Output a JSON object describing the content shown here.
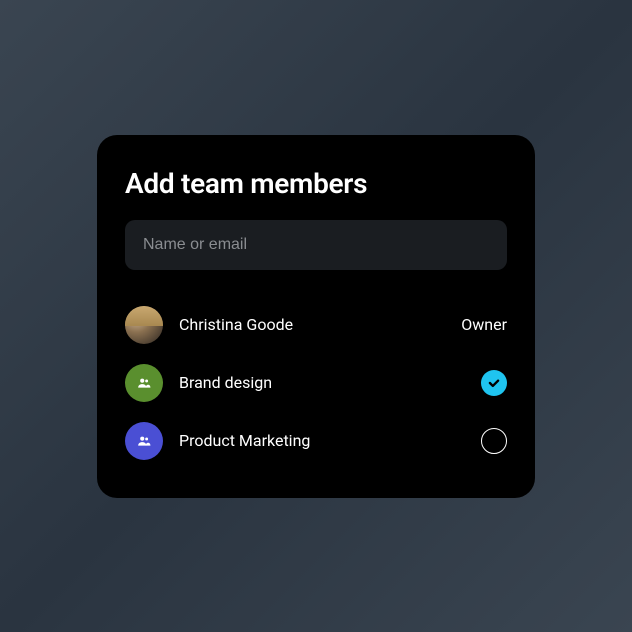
{
  "modal": {
    "title": "Add team members",
    "search_placeholder": "Name or email"
  },
  "members": [
    {
      "name": "Christina Goode",
      "role": "Owner",
      "avatar_type": "photo"
    },
    {
      "name": "Brand design",
      "avatar_type": "group",
      "avatar_color": "green",
      "selected": true
    },
    {
      "name": "Product Marketing",
      "avatar_type": "group",
      "avatar_color": "blue",
      "selected": false
    }
  ],
  "colors": {
    "accent": "#1fc4f0",
    "green": "#5a8f2e",
    "blue": "#4a4fd4"
  }
}
